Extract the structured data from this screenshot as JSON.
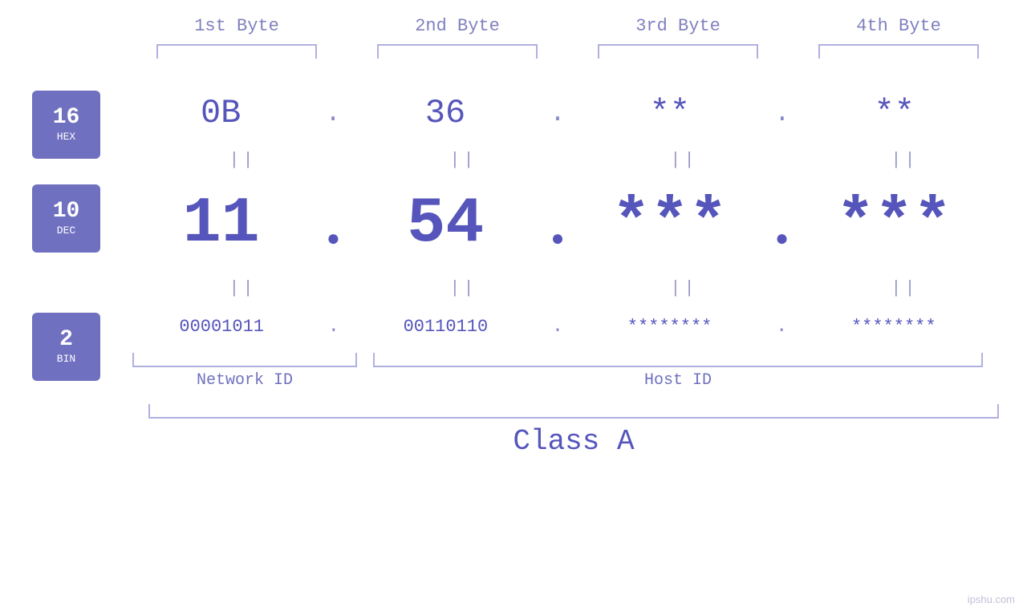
{
  "headers": {
    "byte1": "1st Byte",
    "byte2": "2nd Byte",
    "byte3": "3rd Byte",
    "byte4": "4th Byte"
  },
  "labels": {
    "hex": {
      "num": "16",
      "base": "HEX"
    },
    "dec": {
      "num": "10",
      "base": "DEC"
    },
    "bin": {
      "num": "2",
      "base": "BIN"
    }
  },
  "rows": {
    "hex": {
      "b1": "0B",
      "b2": "36",
      "b3": "**",
      "b4": "**"
    },
    "dec": {
      "b1": "11",
      "b2": "54",
      "b3": "***",
      "b4": "***"
    },
    "bin": {
      "b1": "00001011",
      "b2": "00110110",
      "b3": "********",
      "b4": "********"
    }
  },
  "network_id_label": "Network ID",
  "host_id_label": "Host ID",
  "class_label": "Class A",
  "watermark": "ipshu.com",
  "equals": "||",
  "dot": "."
}
